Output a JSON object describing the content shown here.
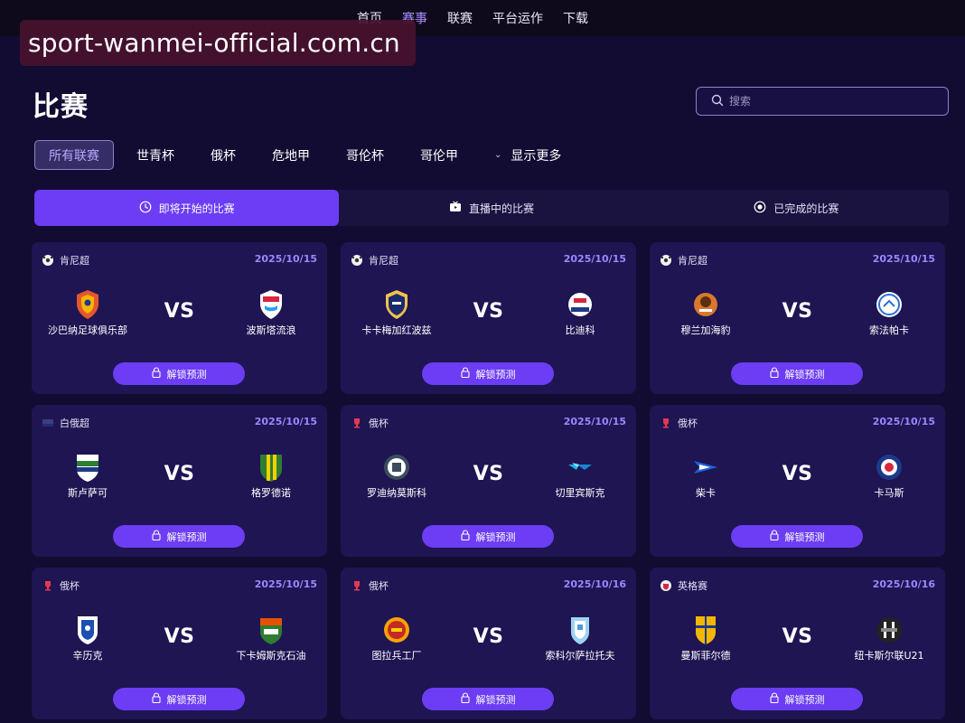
{
  "nav": {
    "items": [
      {
        "label": "首页",
        "active": false
      },
      {
        "label": "赛事",
        "active": true
      },
      {
        "label": "联赛",
        "active": false
      },
      {
        "label": "平台运作",
        "active": false
      },
      {
        "label": "下载",
        "active": false
      }
    ]
  },
  "watermark": "sport-wanmei-official.com.cn",
  "page_title": "比赛",
  "search": {
    "placeholder": "搜索",
    "value": ""
  },
  "filters": {
    "all_label": "所有联赛",
    "items": [
      "世青杯",
      "俄杯",
      "危地甲",
      "哥伦杯",
      "哥伦甲"
    ],
    "more_label": "显示更多"
  },
  "status_tabs": [
    {
      "label": "即将开始的比赛",
      "icon": "clock-icon",
      "active": true
    },
    {
      "label": "直播中的比赛",
      "icon": "tv-icon",
      "active": false
    },
    {
      "label": "已完成的比赛",
      "icon": "radio-dot-icon",
      "active": false
    }
  ],
  "colors": {
    "background": "#120c33",
    "card": "#1e1552",
    "accent": "#6c3df4",
    "date": "#9e86ff",
    "active_text": "#a88bff"
  },
  "vs_label": "VS",
  "unlock_label": "解锁预测",
  "matches": [
    {
      "league": "肯尼超",
      "date": "2025/10/15",
      "home": "沙巴纳足球俱乐部",
      "away": "波斯塔流浪"
    },
    {
      "league": "肯尼超",
      "date": "2025/10/15",
      "home": "卡卡梅加红波兹",
      "away": "比迪科"
    },
    {
      "league": "肯尼超",
      "date": "2025/10/15",
      "home": "穆兰加海豹",
      "away": "索法帕卡"
    },
    {
      "league": "白俄超",
      "date": "2025/10/15",
      "home": "斯卢萨可",
      "away": "格罗德诺"
    },
    {
      "league": "俄杯",
      "date": "2025/10/15",
      "home": "罗迪纳莫斯科",
      "away": "切里宾斯克"
    },
    {
      "league": "俄杯",
      "date": "2025/10/15",
      "home": "柴卡",
      "away": "卡马斯"
    },
    {
      "league": "俄杯",
      "date": "2025/10/15",
      "home": "辛历克",
      "away": "下卡姆斯克石油"
    },
    {
      "league": "俄杯",
      "date": "2025/10/16",
      "home": "图拉兵工厂",
      "away": "索科尔萨拉托夫"
    },
    {
      "league": "英格赛",
      "date": "2025/10/16",
      "home": "曼斯菲尔德",
      "away": "纽卡斯尔联U21"
    }
  ]
}
